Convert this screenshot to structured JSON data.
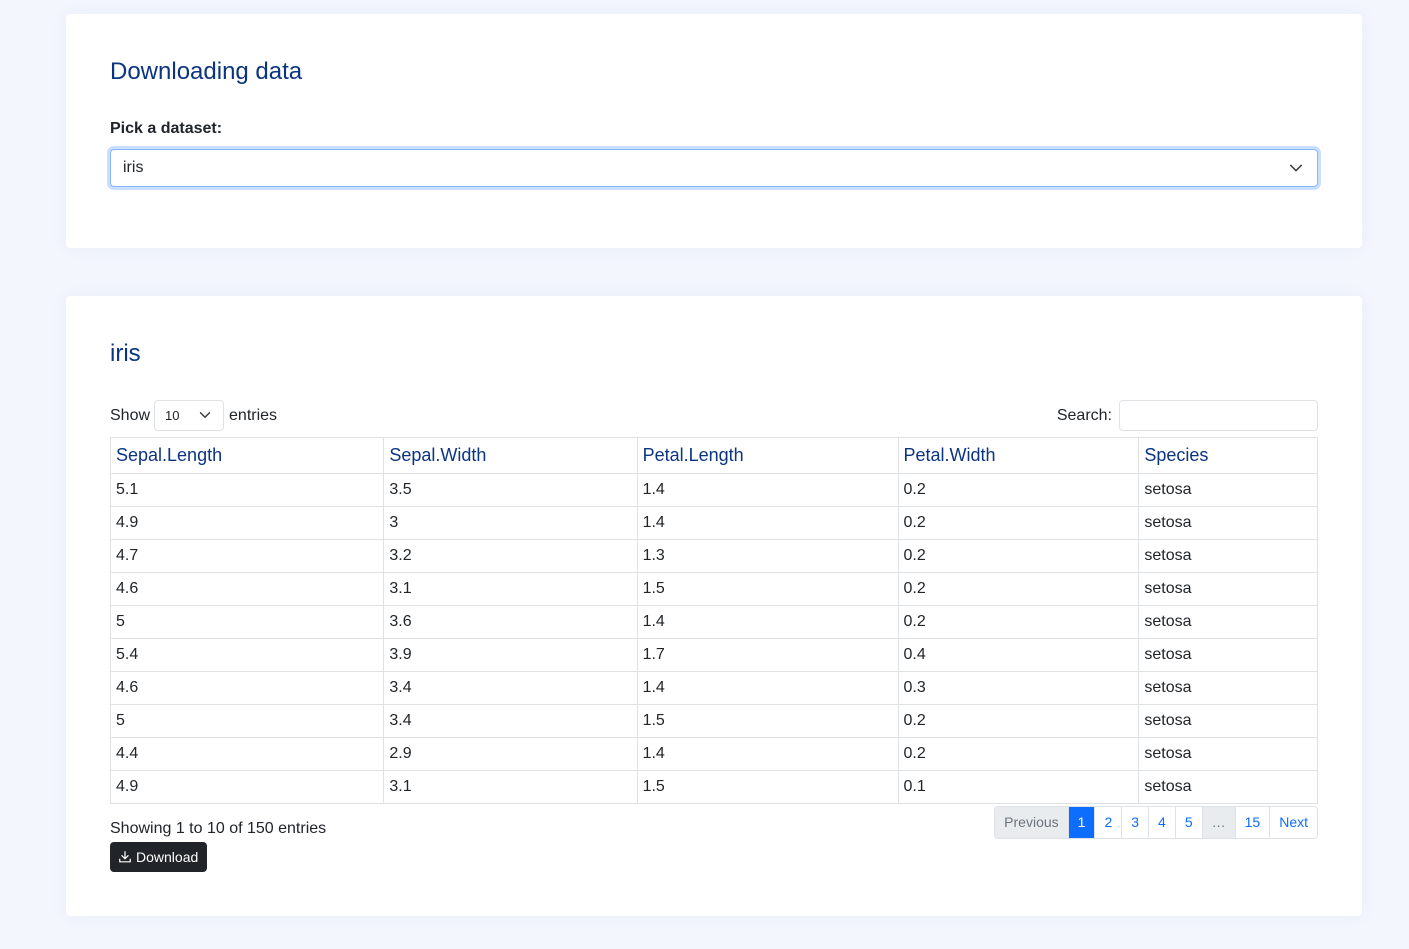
{
  "picker": {
    "title": "Downloading data",
    "label": "Pick a dataset:",
    "selected": "iris"
  },
  "table_card": {
    "title": "iris",
    "length": {
      "prefix": "Show",
      "value": "10",
      "suffix": "entries"
    },
    "search": {
      "label": "Search:",
      "value": ""
    },
    "columns": [
      "Sepal.Length",
      "Sepal.Width",
      "Petal.Length",
      "Petal.Width",
      "Species"
    ],
    "rows": [
      [
        "5.1",
        "3.5",
        "1.4",
        "0.2",
        "setosa"
      ],
      [
        "4.9",
        "3",
        "1.4",
        "0.2",
        "setosa"
      ],
      [
        "4.7",
        "3.2",
        "1.3",
        "0.2",
        "setosa"
      ],
      [
        "4.6",
        "3.1",
        "1.5",
        "0.2",
        "setosa"
      ],
      [
        "5",
        "3.6",
        "1.4",
        "0.2",
        "setosa"
      ],
      [
        "5.4",
        "3.9",
        "1.7",
        "0.4",
        "setosa"
      ],
      [
        "4.6",
        "3.4",
        "1.4",
        "0.3",
        "setosa"
      ],
      [
        "5",
        "3.4",
        "1.5",
        "0.2",
        "setosa"
      ],
      [
        "4.4",
        "2.9",
        "1.4",
        "0.2",
        "setosa"
      ],
      [
        "4.9",
        "3.1",
        "1.5",
        "0.1",
        "setosa"
      ]
    ],
    "info": "Showing 1 to 10 of 150 entries",
    "pagination": {
      "previous": "Previous",
      "pages": [
        "1",
        "2",
        "3",
        "4",
        "5"
      ],
      "ellipsis": "…",
      "last": "15",
      "next": "Next",
      "current": "1"
    },
    "download_label": "Download"
  },
  "colors": {
    "page_bg": "#f3f6fd",
    "heading": "#0b3481",
    "accent": "#0d6efd",
    "button_dark": "#212529"
  },
  "icons": {
    "select_caret": "chevron-down-icon",
    "download": "download-icon"
  }
}
